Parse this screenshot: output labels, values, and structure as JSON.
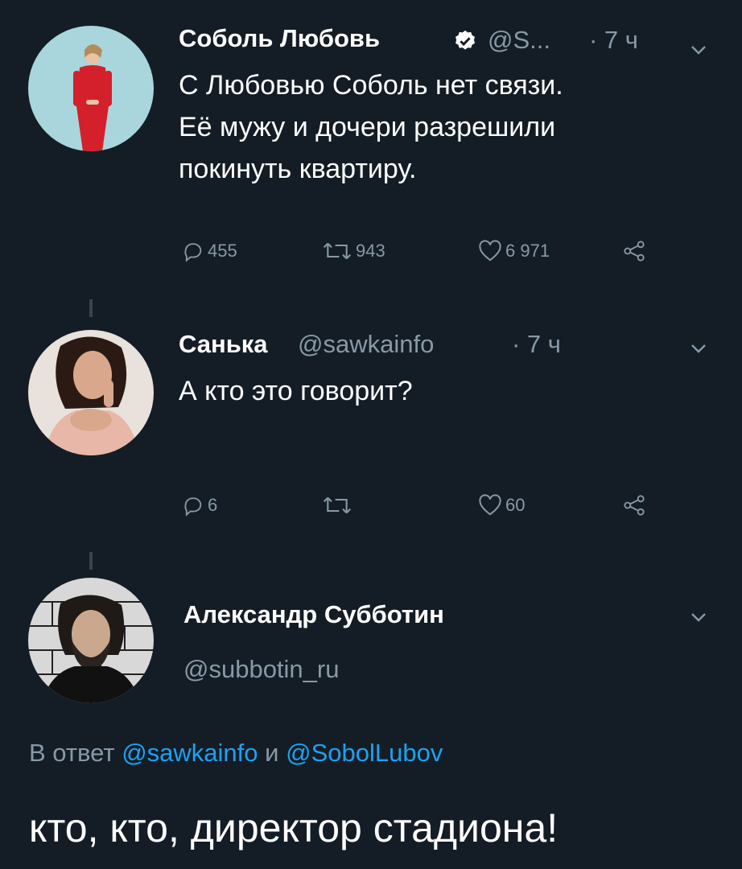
{
  "tweets": [
    {
      "name": "Соболь Любовь",
      "handle": "@S...",
      "time": "· 7 ч",
      "text_lines": [
        "С Любовью Соболь нет связи.",
        "Её мужу и дочери разрешили",
        "покинуть квартиру."
      ],
      "replies": "455",
      "retweets": "943",
      "likes": "6 971"
    },
    {
      "name": "Санька",
      "handle": "@sawkainfo",
      "time": "· 7 ч",
      "text_lines": [
        "А кто это говорит?"
      ],
      "replies": "6",
      "likes": "60"
    },
    {
      "name": "Александр Субботин",
      "handle": "@subbotin_ru",
      "reply_prefix": "В ответ",
      "reply_to_1": "@sawkainfo",
      "reply_conj": "и",
      "reply_to_2": "@SobolLubov",
      "text": "кто, кто, директор стадиона!"
    }
  ],
  "colors": {
    "background": "#141d26",
    "secondary_text": "#8899a6",
    "link": "#1da1f2",
    "verified": "#ffffff"
  },
  "icons": [
    "verified-badge-icon",
    "reply-icon",
    "retweet-icon",
    "like-icon",
    "share-icon",
    "chevron-down-icon"
  ]
}
